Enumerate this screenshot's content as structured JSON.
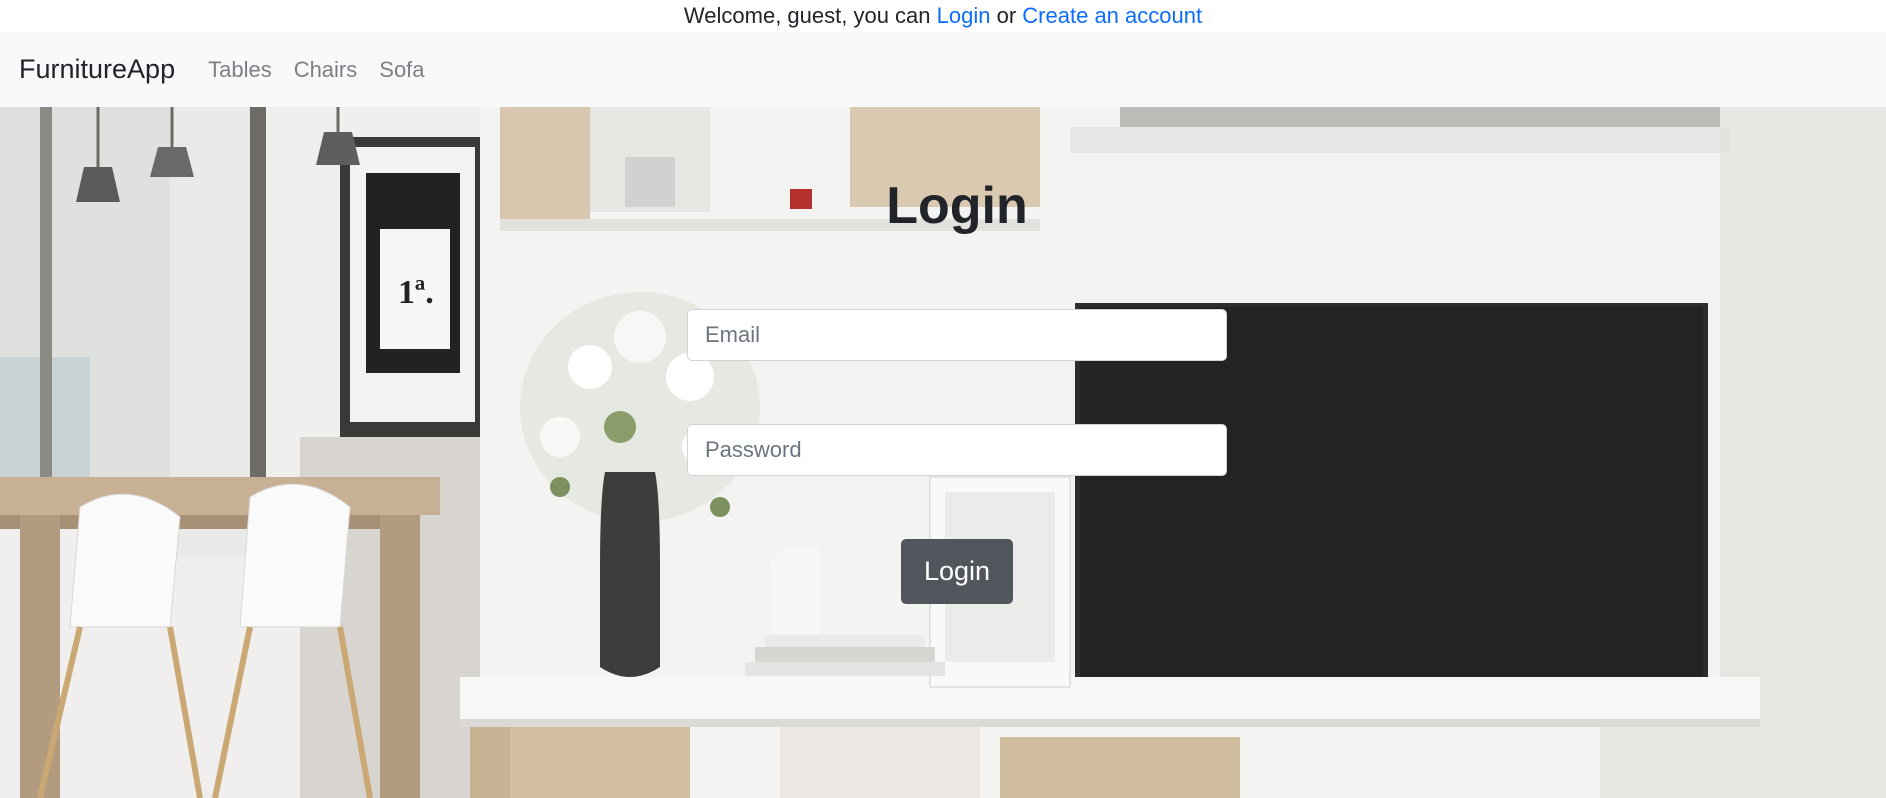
{
  "topbar": {
    "prefix": "Welcome, guest, you can ",
    "login_link": "Login",
    "middle": " or ",
    "create_link": "Create an account"
  },
  "navbar": {
    "brand": "FurnitureApp",
    "links": [
      "Tables",
      "Chairs",
      "Sofa"
    ]
  },
  "form": {
    "title": "Login",
    "email_placeholder": "Email",
    "password_placeholder": "Password",
    "submit_label": "Login"
  },
  "scene": {
    "poster_text": "1ª."
  },
  "colors": {
    "link": "#0d6efd",
    "navbar_bg": "#f8f9fa",
    "button_bg": "#50565c"
  }
}
